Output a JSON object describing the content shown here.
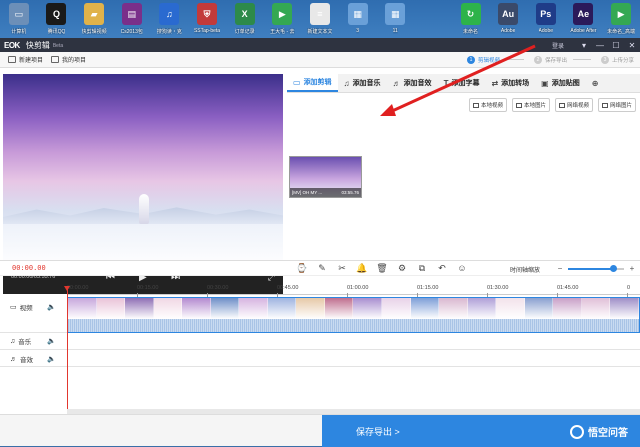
{
  "desktop": {
    "icons": [
      {
        "label": "计算机",
        "color": "#6c8fb8",
        "glyph": "▭"
      },
      {
        "label": "腾讯QQ",
        "color": "#1a1a1a",
        "glyph": "Q"
      },
      {
        "label": "快剪辑视频",
        "color": "#e0b24a",
        "glyph": "▰"
      },
      {
        "label": "Cs2013包",
        "color": "#7a2f8a",
        "glyph": "▤"
      },
      {
        "label": "搜狗读・克",
        "color": "#2a6ad0",
        "glyph": "♫"
      },
      {
        "label": "SSTap-beta",
        "color": "#c23a3a",
        "glyph": "⛨"
      },
      {
        "label": "订单记录",
        "color": "#2d8a4a",
        "glyph": "X"
      },
      {
        "label": "王大毛 - 去",
        "color": "#34a853",
        "glyph": "▶"
      },
      {
        "label": "新建文本文",
        "color": "#e8e8e8",
        "glyph": "≡"
      },
      {
        "label": "3",
        "color": "#6aa0d8",
        "glyph": "▦"
      },
      {
        "label": "11",
        "color": "#6aa0d8",
        "glyph": "▦"
      },
      {
        "label": "",
        "color": "transparent",
        "glyph": ""
      },
      {
        "label": "未命名",
        "color": "#2db34a",
        "glyph": "↻"
      },
      {
        "label": "Adobe",
        "color": "#3a4a6a",
        "glyph": "Au"
      },
      {
        "label": "Adobe",
        "color": "#1f3c88",
        "glyph": "Ps"
      },
      {
        "label": "Adobe After",
        "color": "#2b1a5a",
        "glyph": "Ae"
      },
      {
        "label": "未命名_高端",
        "color": "#34a853",
        "glyph": "▶"
      }
    ]
  },
  "window": {
    "logo": "EOK",
    "title": "快剪辑",
    "subtitle": "Beta",
    "login": "登录",
    "controls": [
      "▾",
      "—",
      "☐",
      "✕"
    ]
  },
  "toolbar": {
    "new_project": "新建项目",
    "my_projects": "我的项目",
    "steps": [
      {
        "num": "1",
        "label": "剪辑视频",
        "active": true
      },
      {
        "num": "2",
        "label": "保存导出",
        "active": false
      },
      {
        "num": "3",
        "label": "上传分享",
        "active": false
      }
    ]
  },
  "preview": {
    "timecode": "00:00.00/03:55.76",
    "prev": "⏮",
    "play": "▶",
    "next": "⏭",
    "fullscreen": "⤢"
  },
  "tabs": [
    {
      "icon": "▭",
      "label": "添加剪辑",
      "active": true
    },
    {
      "icon": "♫",
      "label": "添加音乐",
      "active": false
    },
    {
      "icon": "♬",
      "label": "添加音效",
      "active": false
    },
    {
      "icon": "T",
      "label": "添加字幕",
      "active": false
    },
    {
      "icon": "⇄",
      "label": "添加转场",
      "active": false
    },
    {
      "icon": "▣",
      "label": "添加贴图",
      "active": false
    },
    {
      "icon": "⊕",
      "label": "",
      "active": false
    }
  ],
  "add_buttons": [
    "本地视频",
    "本地图片",
    "网络视频",
    "网络图片"
  ],
  "clip": {
    "name": "[MV] OH MY ...",
    "duration": "03:55.76"
  },
  "timeline": {
    "current_time": "00:00.00",
    "tools": [
      "⌚",
      "✎",
      "✂",
      "🔔",
      "🗑",
      "⚙",
      "⧉",
      "↶",
      "☺"
    ],
    "zoom_label": "时间轴缩放",
    "zoom_minus": "−",
    "zoom_plus": "+",
    "zoom_level": 0.8,
    "ruler": [
      "00:00.00",
      "00:15.00",
      "00:30.00",
      "00:45.00",
      "01:00.00",
      "01:15.00",
      "01:30.00",
      "01:45.00",
      "0"
    ],
    "tracks": [
      {
        "icon": "▭",
        "label": "视频",
        "speaker": "🔈"
      },
      {
        "icon": "♫",
        "label": "音乐",
        "speaker": "🔈"
      },
      {
        "icon": "♬",
        "label": "音效",
        "speaker": "🔈"
      }
    ]
  },
  "export": {
    "label": "保存导出  >"
  },
  "watermark": "悟空问答"
}
